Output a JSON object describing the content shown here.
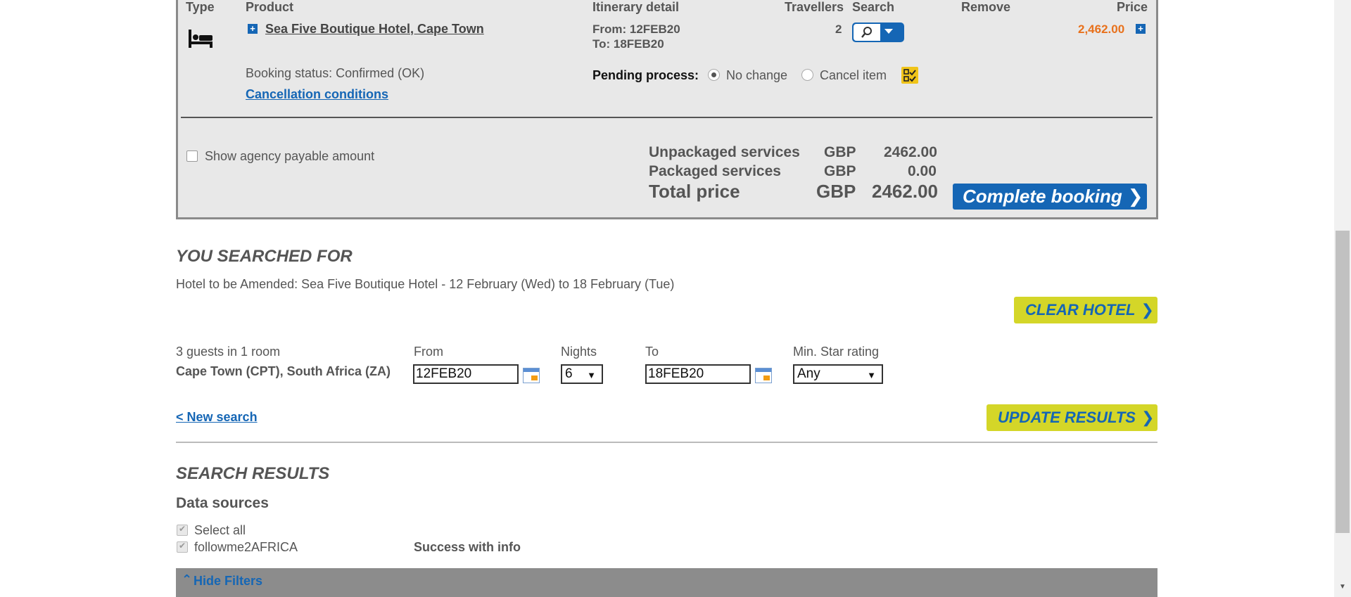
{
  "table": {
    "headers": {
      "type": "Type",
      "product": "Product",
      "itinerary": "Itinerary detail",
      "travellers": "Travellers",
      "search": "Search",
      "remove": "Remove",
      "price": "Price"
    },
    "row": {
      "icon": "bed-icon",
      "hotel_name": "Sea Five Boutique Hotel, Cape Town",
      "from": "From: 12FEB20",
      "to": "To: 18FEB20",
      "travellers": "2",
      "price": "2,462.00",
      "price_color": "#e8711c",
      "booking_status": "Booking status: Confirmed (OK)",
      "cancellation_link": "Cancellation conditions",
      "pending_label": "Pending process:",
      "pending_options": [
        "No change",
        "Cancel item"
      ],
      "pending_selected": "No change"
    }
  },
  "totals": {
    "show_agency_label": "Show agency payable amount",
    "unpackaged_label": "Unpackaged services",
    "unpackaged_currency": "GBP",
    "unpackaged_amount": "2462.00",
    "packaged_label": "Packaged services",
    "packaged_currency": "GBP",
    "packaged_amount": "0.00",
    "total_label": "Total price",
    "total_currency": "GBP",
    "total_amount": "2462.00",
    "complete_button": "Complete booking"
  },
  "searched": {
    "title": "YOU SEARCHED FOR",
    "summary": "Hotel to be Amended: Sea Five Boutique Hotel - 12 February (Wed) to 18 February (Tue)",
    "clear_button": "CLEAR HOTEL",
    "guests": "3 guests in 1 room",
    "location": "Cape Town (CPT), South Africa (ZA)",
    "from_label": "From",
    "from_value": "12FEB20",
    "nights_label": "Nights",
    "nights_value": "6",
    "to_label": "To",
    "to_value": "18FEB20",
    "star_label": "Min. Star rating",
    "star_value": "Any",
    "new_search": "< New search",
    "update_button": "UPDATE RESULTS"
  },
  "results": {
    "title": "SEARCH RESULTS",
    "data_sources_title": "Data sources",
    "select_all": "Select all",
    "source_name": "followme2AFRICA",
    "source_status": "Success with info",
    "hide_filters": "Hide Filters"
  },
  "colors": {
    "accent_blue": "#1566b5",
    "accent_yellow": "#d4d628",
    "panel_bg": "#e8e8e8"
  }
}
